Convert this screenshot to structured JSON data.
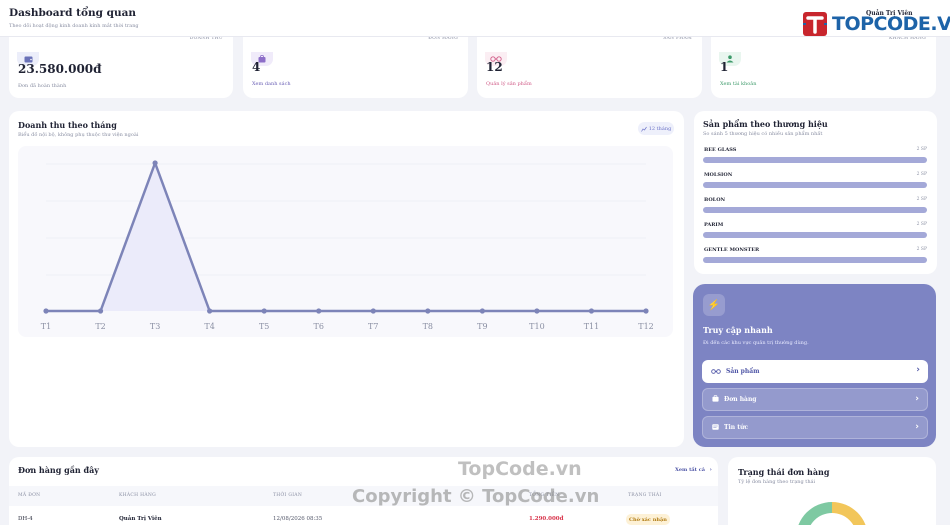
{
  "header": {
    "title": "Dashboard tổng quan",
    "subtitle": "Theo dõi hoạt động kinh doanh kính mắt thời trang",
    "admin_name": "Quản Trị Viên"
  },
  "logo": {
    "text": "TOPCODE.VN",
    "mark": "T"
  },
  "stats": [
    {
      "label": "DOANH THU",
      "value": "23.580.000đ",
      "link": "Đơn đã hoàn thành",
      "icon": "wallet-icon",
      "color": "#6a72b8",
      "bg": "#eceefa"
    },
    {
      "label": "ĐƠN HÀNG",
      "value": "4",
      "link": "Xem danh sách",
      "icon": "bag-icon",
      "color": "#8d6ec8",
      "bg": "#f0ebfa"
    },
    {
      "label": "SẢN PHẨM",
      "value": "12",
      "link": "Quản lý sản phẩm",
      "icon": "glasses-icon",
      "color": "#d05a86",
      "bg": "#fbeef3"
    },
    {
      "label": "KHÁCH HÀNG",
      "value": "1",
      "link": "Xem tài khoản",
      "icon": "users-icon",
      "color": "#3d9a6a",
      "bg": "#e9f6ef"
    }
  ],
  "revenue": {
    "title": "Doanh thu theo tháng",
    "subtitle": "Biểu đồ nội bộ, không phụ thuộc thư viện ngoài",
    "pill": "12 tháng"
  },
  "chart_data": {
    "type": "area",
    "categories": [
      "T1",
      "T2",
      "T3",
      "T4",
      "T5",
      "T6",
      "T7",
      "T8",
      "T9",
      "T10",
      "T11",
      "T12"
    ],
    "series": [
      {
        "values": [
          0,
          0,
          23580000,
          0,
          0,
          0,
          0,
          0,
          0,
          0,
          0,
          0
        ]
      }
    ],
    "grid": true
  },
  "brands": {
    "title": "Sản phẩm theo thương hiệu",
    "subtitle": "So sánh 5 thương hiệu có nhiều sản phẩm nhất",
    "items": [
      {
        "name": "BEE GLASS",
        "count": "2 SP",
        "level": 1
      },
      {
        "name": "MOLSION",
        "count": "2 SP",
        "level": 1
      },
      {
        "name": "BOLON",
        "count": "2 SP",
        "level": 1
      },
      {
        "name": "PARIM",
        "count": "2 SP",
        "level": 1
      },
      {
        "name": "GENTLE MONSTER",
        "count": "2 SP",
        "level": 1
      }
    ]
  },
  "quick_access": {
    "title": "Truy cập nhanh",
    "subtitle": "Đi đến các khu vực quản trị thường dùng.",
    "buttons": [
      {
        "label": "Sản phẩm",
        "icon": "glasses-icon"
      },
      {
        "label": "Đơn hàng",
        "icon": "bag-icon"
      },
      {
        "label": "Tin tức",
        "icon": "news-icon"
      }
    ]
  },
  "orders": {
    "title": "Đơn hàng gần đây",
    "view_all": "Xem tất cả",
    "columns": [
      "MÃ ĐƠN",
      "KHÁCH HÀNG",
      "THỜI GIAN",
      "TỔNG TIỀN",
      "TRẠNG THÁI"
    ],
    "rows": [
      {
        "id": "DH-4",
        "customer": "Quản Trị Viên",
        "time": "12/08/2026 08:35",
        "total": "1.290.000đ",
        "status": "Chờ xác nhận"
      }
    ]
  },
  "order_status": {
    "title": "Trạng thái đơn hàng",
    "subtitle": "Tỷ lệ đơn hàng theo trạng thái",
    "segments": [
      {
        "color": "#7ec9a2",
        "share": 0.5
      },
      {
        "color": "#f2c65a",
        "share": 0.5
      }
    ]
  },
  "watermarks": {
    "main": "TopCode.vn",
    "copyright": "Copyright © TopCode.vn"
  }
}
